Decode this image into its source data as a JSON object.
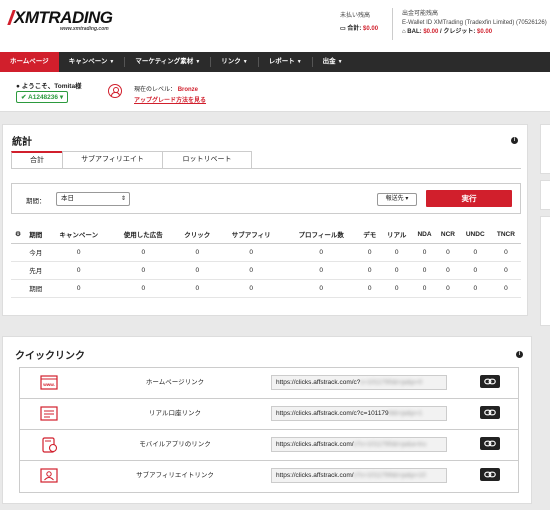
{
  "header": {
    "logo_text": "XMTRADING",
    "logo_sub": "www.xmtrading.com",
    "unpaid_label": "未払い残高",
    "unpaid_total_label": "合計:",
    "unpaid_total_value": "$0.00",
    "withdraw_label": "出金可能残高",
    "ewallet_text": "E-Wallet ID XMTrading (Tradexfin Limited) (70526126)",
    "bal_label": "BAL:",
    "bal_value": "$0.00",
    "credit_label": "/ クレジット:",
    "credit_value": "$0.00"
  },
  "nav": {
    "items": [
      "ホームページ",
      "キャンペーン",
      "マーケティング素材",
      "リンク",
      "レポート",
      "出金"
    ]
  },
  "user": {
    "welcome": "ようこそ、Tomita様",
    "account": "A1248236",
    "level_label": "現在のレベル：",
    "level_value": "Bronze",
    "upgrade_link": "アップグレード方法を見る"
  },
  "stats": {
    "title": "統計",
    "tabs": [
      "合計",
      "サブアフィリエイト",
      "ロットリベート"
    ],
    "period_label": "期間：",
    "period_value": "本日",
    "currency_button": "報送先",
    "run_button": "実行",
    "columns": [
      "期間",
      "キャンペーン",
      "使用した広告",
      "クリック",
      "サブアフィリ",
      "プロフィール数",
      "デモ",
      "リアル",
      "NDA",
      "NCR",
      "UNDC",
      "TNCR"
    ],
    "rows": [
      [
        "今月",
        "0",
        "0",
        "0",
        "0",
        "0",
        "0",
        "0",
        "0",
        "0",
        "0",
        "0"
      ],
      [
        "先月",
        "0",
        "0",
        "0",
        "0",
        "0",
        "0",
        "0",
        "0",
        "0",
        "0",
        "0"
      ],
      [
        "期間",
        "0",
        "0",
        "0",
        "0",
        "0",
        "0",
        "0",
        "0",
        "0",
        "0",
        "0"
      ]
    ]
  },
  "quick": {
    "title": "クイックリンク",
    "links": [
      {
        "name": "ホームページリンク",
        "url_visible": "https://clicks.affstrack.com/c?",
        "url_blurred": "c=1011795&l=ja&p=0"
      },
      {
        "name": "リアル口座リンク",
        "url_visible": "https://clicks.affstrack.com/c?c=101179",
        "url_blurred": "8&l=ja&p=1"
      },
      {
        "name": "モバイルアプリのリンク",
        "url_visible": "https://clicks.affstrack.com/",
        "url_blurred": "c?c=1011795&l=ja&a=tru"
      },
      {
        "name": "サブアフィリエイトリンク",
        "url_visible": "https://clicks.affstrack.com/",
        "url_blurred": "c?c=1011799&l=ja&p=10"
      }
    ]
  },
  "colors": {
    "brand_red": "#d11f2c",
    "nav_bg": "#2b2b2b",
    "success_green": "#2c9a3e"
  }
}
